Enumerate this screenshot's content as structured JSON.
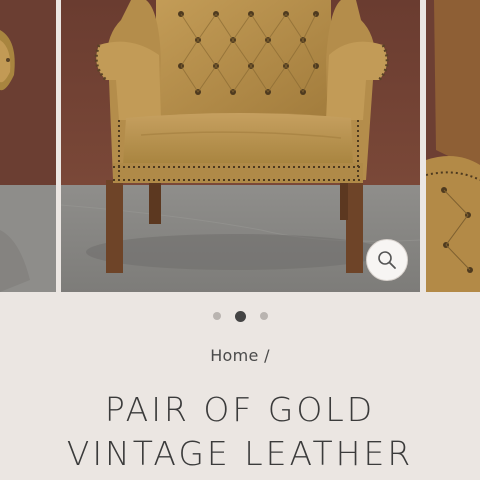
{
  "gallery": {
    "slide_count": 3,
    "active_index": 1,
    "images": [
      "chair-side-view",
      "gold-leather-wing-chair",
      "chair-tufted-detail"
    ]
  },
  "breadcrumb": {
    "home": "Home",
    "separator": "/"
  },
  "product": {
    "title_line1": "PAIR OF GOLD",
    "title_line2": "VINTAGE LEATHER"
  },
  "colors": {
    "background": "#ebe6e2",
    "wall": "#6d3f33",
    "floor": "#8b8a87",
    "leather": "#b8914f",
    "dot_active": "#444444",
    "dot_inactive": "#b9b4b0"
  },
  "icons": {
    "zoom": "magnifier-icon"
  }
}
